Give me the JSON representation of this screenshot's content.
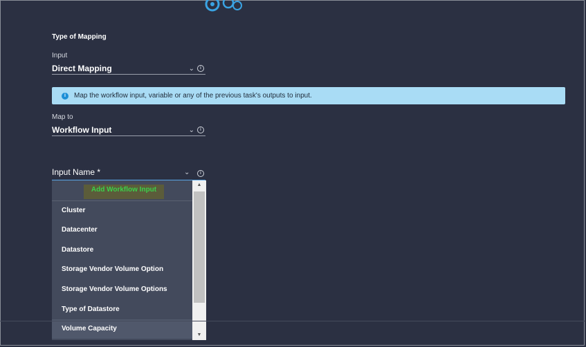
{
  "section": {
    "title": "Type of Mapping"
  },
  "input": {
    "label": "Input",
    "value": "Direct Mapping"
  },
  "banner": {
    "text": "Map the workflow input, variable or any of the previous task's outputs to input."
  },
  "map_to": {
    "label": "Map to",
    "value": "Workflow Input"
  },
  "input_name": {
    "label": "Input Name *"
  },
  "dropdown": {
    "add_label": "Add Workflow Input",
    "items": [
      "Cluster",
      "Datacenter",
      "Datastore",
      "Storage Vendor Volume Option",
      "Storage Vendor Volume Options",
      "Type of Datastore",
      "Volume Capacity"
    ]
  },
  "colors": {
    "background": "#2b3042",
    "banner": "#a9dcf5",
    "accent_blue": "#1d8fd6",
    "add_text": "#3bd14a"
  },
  "icons": [
    "gears-logo-icon",
    "chevron-down-icon",
    "info-icon",
    "scroll-up-icon",
    "scroll-down-icon"
  ]
}
